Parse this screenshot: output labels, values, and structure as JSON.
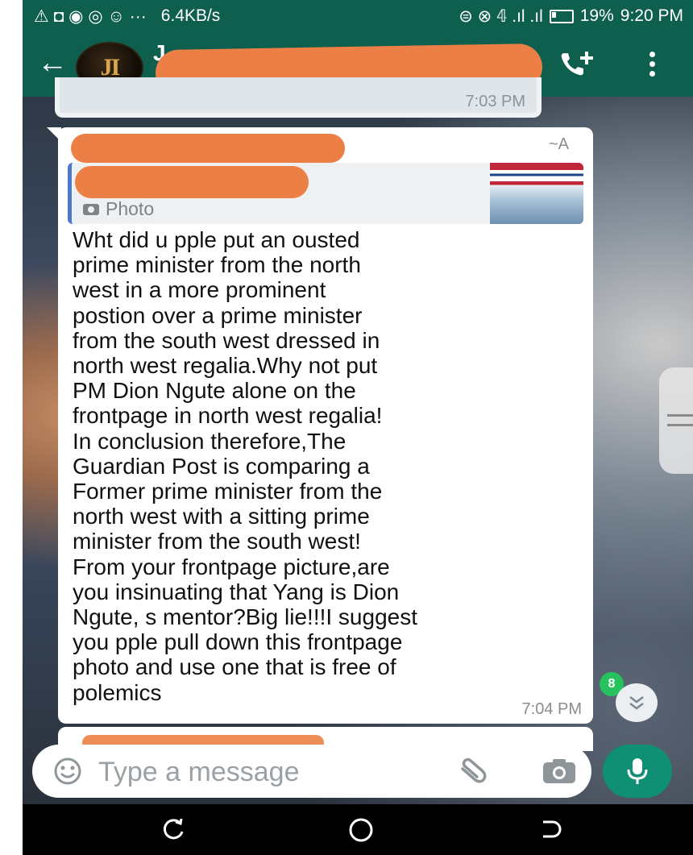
{
  "status_bar": {
    "left_glyphs": "⚠ ◘ ◉ ◎ ☺ ···",
    "speed": "6.4KB/s",
    "signal": "⊜ ⊗ 𝟜 .ıl .ıl",
    "battery": "19%",
    "time": "9:20 PM"
  },
  "header": {
    "avatar_text": "JI",
    "chat_title": "J",
    "back_icon": "arrow-left-icon",
    "call_icon": "add-call-icon",
    "menu_icon": "more-vert-icon"
  },
  "previous_message": {
    "time": "7:03 PM"
  },
  "message": {
    "sender_suffix": "~A",
    "quoted_label": "Photo",
    "text": "Wht did u pple put an ousted\nprime minister from the north\nwest in a more prominent\npostion over a prime minister\nfrom the south west dressed in\nnorth west regalia.Why not put\nPM Dion Ngute alone on the\nfrontpage in north west regalia!\nIn conclusion therefore,The\nGuardian Post is comparing a\nFormer prime minister from the\nnorth west with a sitting prime\nminister from the south west!\nFrom your frontpage picture,are\nyou insinuating that Yang is Dion\nNgute, s mentor?Big lie!!!I suggest\nyou pple pull down this frontpage\nphoto and use one that is free of\npolemics",
    "time": "7:04 PM"
  },
  "scroll": {
    "unread_count": "8",
    "icon": "double-chevron-down-icon"
  },
  "composer": {
    "placeholder": "Type a message",
    "emoji_icon": "emoji-icon",
    "attach_icon": "paperclip-icon",
    "camera_icon": "camera-icon",
    "mic_icon": "mic-icon"
  },
  "colors": {
    "header_green": "#0f5f4e",
    "redaction_orange": "#ec7f45",
    "mic_green": "#0f8f74",
    "badge_green": "#25c25e"
  }
}
